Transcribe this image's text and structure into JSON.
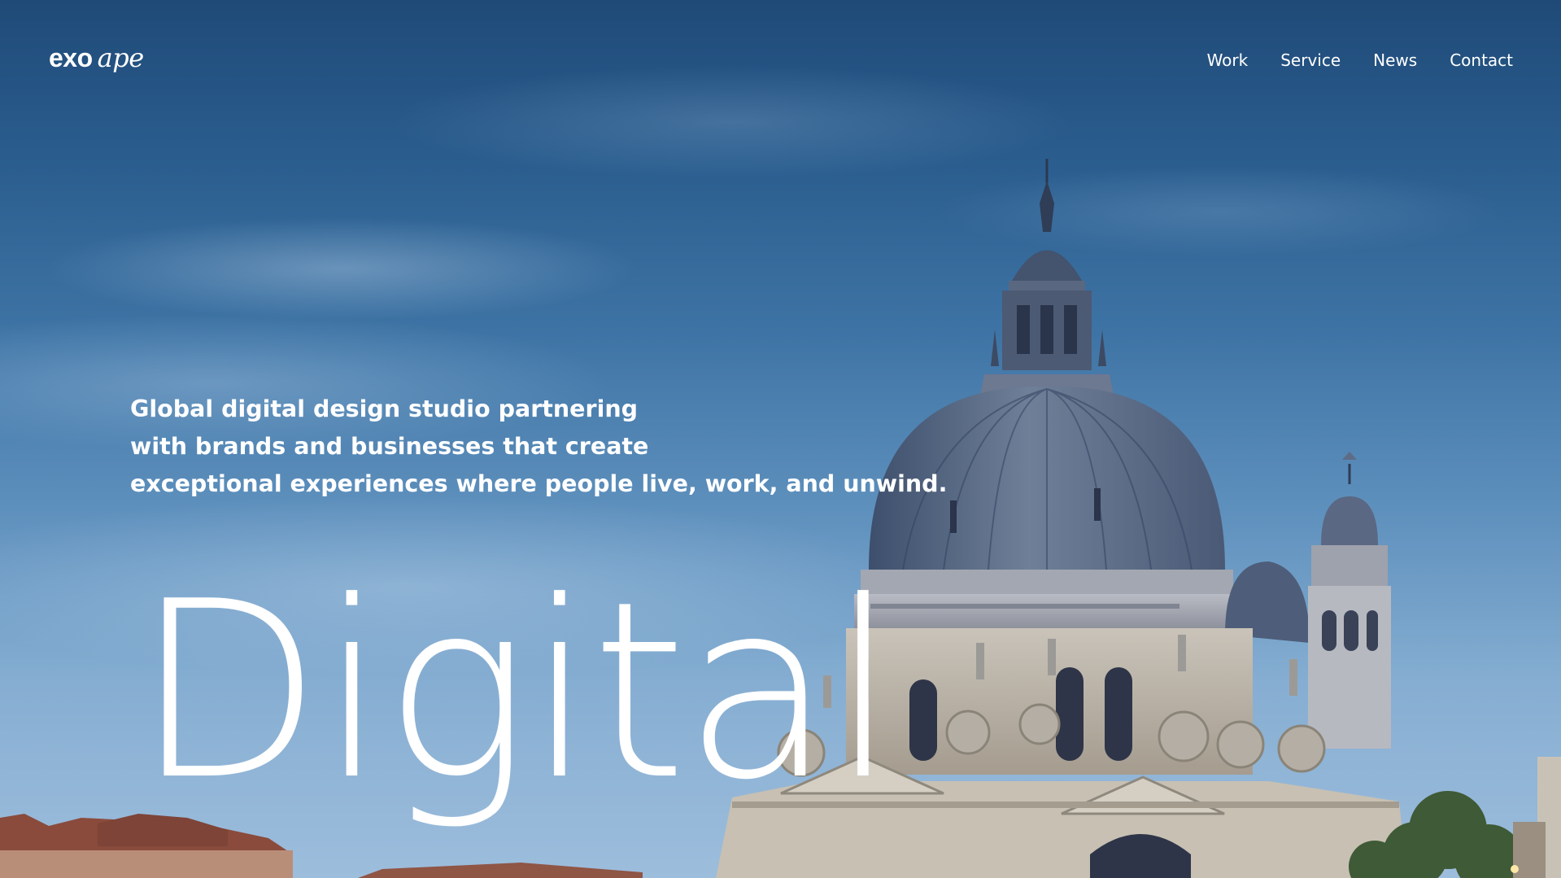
{
  "brand": {
    "logo_part1": "exo",
    "logo_part2": "ape"
  },
  "nav": {
    "items": [
      {
        "label": "Work"
      },
      {
        "label": "Service"
      },
      {
        "label": "News"
      },
      {
        "label": "Contact"
      }
    ]
  },
  "hero": {
    "tagline_lines": [
      "Global digital design studio partnering",
      "with brands and businesses that create",
      "exceptional experiences where people live, work, and unwind."
    ],
    "headline": "Digital",
    "background_image": "basilica-dome-dusk-sky"
  },
  "colors": {
    "text": "#ffffff",
    "sky_top": "#1f4a78",
    "sky_bottom": "#9dbddc"
  }
}
